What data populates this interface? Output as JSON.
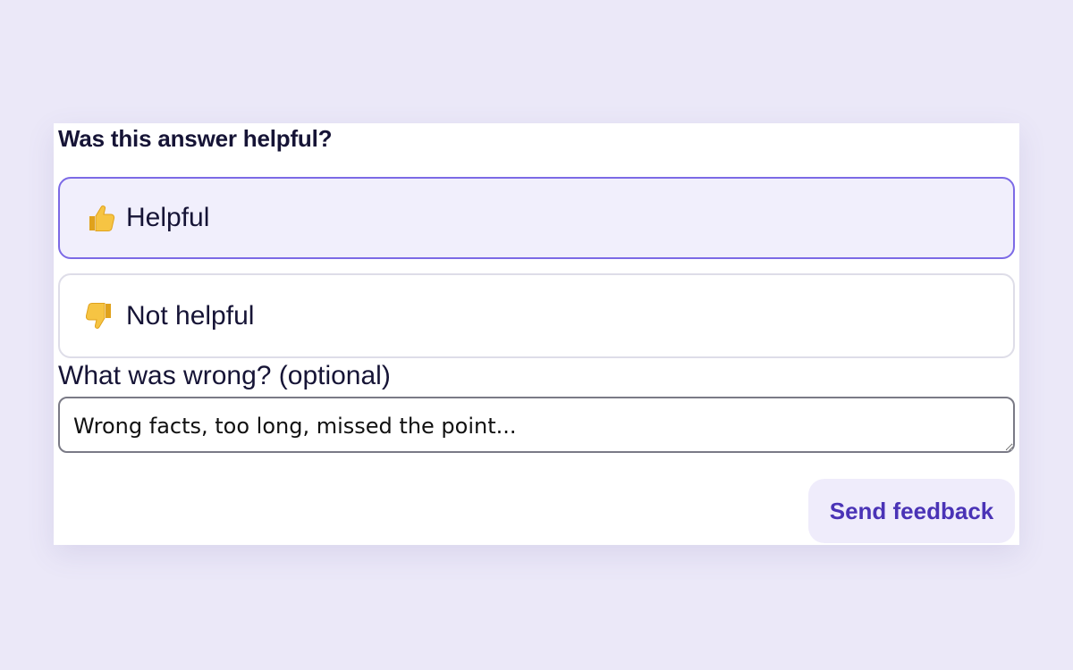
{
  "feedback": {
    "question": "Was this answer helpful?",
    "options": [
      {
        "label": "Helpful",
        "icon": "thumbs-up-icon",
        "selected": true
      },
      {
        "label": "Not helpful",
        "icon": "thumbs-down-icon",
        "selected": false
      }
    ],
    "comment_label": "What was wrong? (optional)",
    "comment_placeholder": "Wrong facts, too long, missed the point...",
    "comment_value": "",
    "submit_label": "Send feedback"
  },
  "colors": {
    "background": "#ebe8f8",
    "accent": "#7c6ae6",
    "selected_fill": "#f1effc",
    "button_text": "#4a33b6",
    "button_fill": "#efecfb",
    "icon": "#f6c443"
  }
}
